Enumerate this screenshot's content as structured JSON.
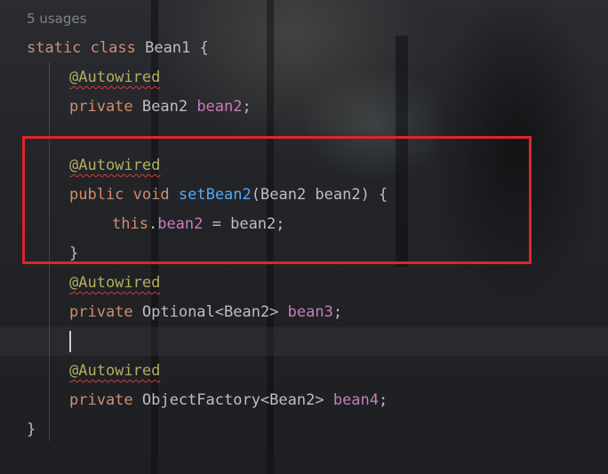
{
  "editor": {
    "usages_hint": "5 usages",
    "lines": [
      {
        "tokens": [
          {
            "t": "static",
            "c": "kw"
          },
          {
            "t": " ",
            "c": "plain"
          },
          {
            "t": "class",
            "c": "kw"
          },
          {
            "t": " Bean1 {",
            "c": "plain"
          }
        ]
      },
      {
        "tokens": [
          {
            "t": "@Autowired",
            "c": "ann"
          }
        ]
      },
      {
        "tokens": [
          {
            "t": "private",
            "c": "kw"
          },
          {
            "t": " Bean2 ",
            "c": "plain"
          },
          {
            "t": "bean2",
            "c": "field"
          },
          {
            "t": ";",
            "c": "plain"
          }
        ]
      },
      {
        "tokens": []
      },
      {
        "tokens": [
          {
            "t": "@Autowired",
            "c": "ann"
          }
        ]
      },
      {
        "tokens": [
          {
            "t": "public",
            "c": "kw"
          },
          {
            "t": " ",
            "c": "plain"
          },
          {
            "t": "void",
            "c": "kw"
          },
          {
            "t": " ",
            "c": "plain"
          },
          {
            "t": "setBean2",
            "c": "fn"
          },
          {
            "t": "(Bean2 bean2) {",
            "c": "plain"
          }
        ]
      },
      {
        "tokens": [
          {
            "t": "this",
            "c": "kw"
          },
          {
            "t": ".",
            "c": "plain"
          },
          {
            "t": "bean2",
            "c": "field"
          },
          {
            "t": " = bean2;",
            "c": "plain"
          }
        ]
      },
      {
        "tokens": [
          {
            "t": "}",
            "c": "plain"
          }
        ]
      },
      {
        "tokens": [
          {
            "t": "@Autowired",
            "c": "ann"
          }
        ]
      },
      {
        "tokens": [
          {
            "t": "private",
            "c": "kw"
          },
          {
            "t": " Optional<Bean2> ",
            "c": "plain"
          },
          {
            "t": "bean3",
            "c": "field"
          },
          {
            "t": ";",
            "c": "plain"
          }
        ]
      },
      {
        "tokens": [
          {
            "t": "",
            "c": "caret"
          }
        ]
      },
      {
        "tokens": [
          {
            "t": "@Autowired",
            "c": "ann"
          }
        ]
      },
      {
        "tokens": [
          {
            "t": "private",
            "c": "kw"
          },
          {
            "t": " ObjectFactory<Bean2> ",
            "c": "plain"
          },
          {
            "t": "bean4",
            "c": "field"
          },
          {
            "t": ";",
            "c": "plain"
          }
        ]
      },
      {
        "tokens": [
          {
            "t": "}",
            "c": "plain"
          }
        ]
      }
    ]
  },
  "colors": {
    "keyword": "#cf8e6d",
    "annotation": "#b3ae60",
    "field": "#c77dbb",
    "method": "#56a8f5",
    "text": "#bcbec4",
    "highlight_box": "#e0242c"
  }
}
